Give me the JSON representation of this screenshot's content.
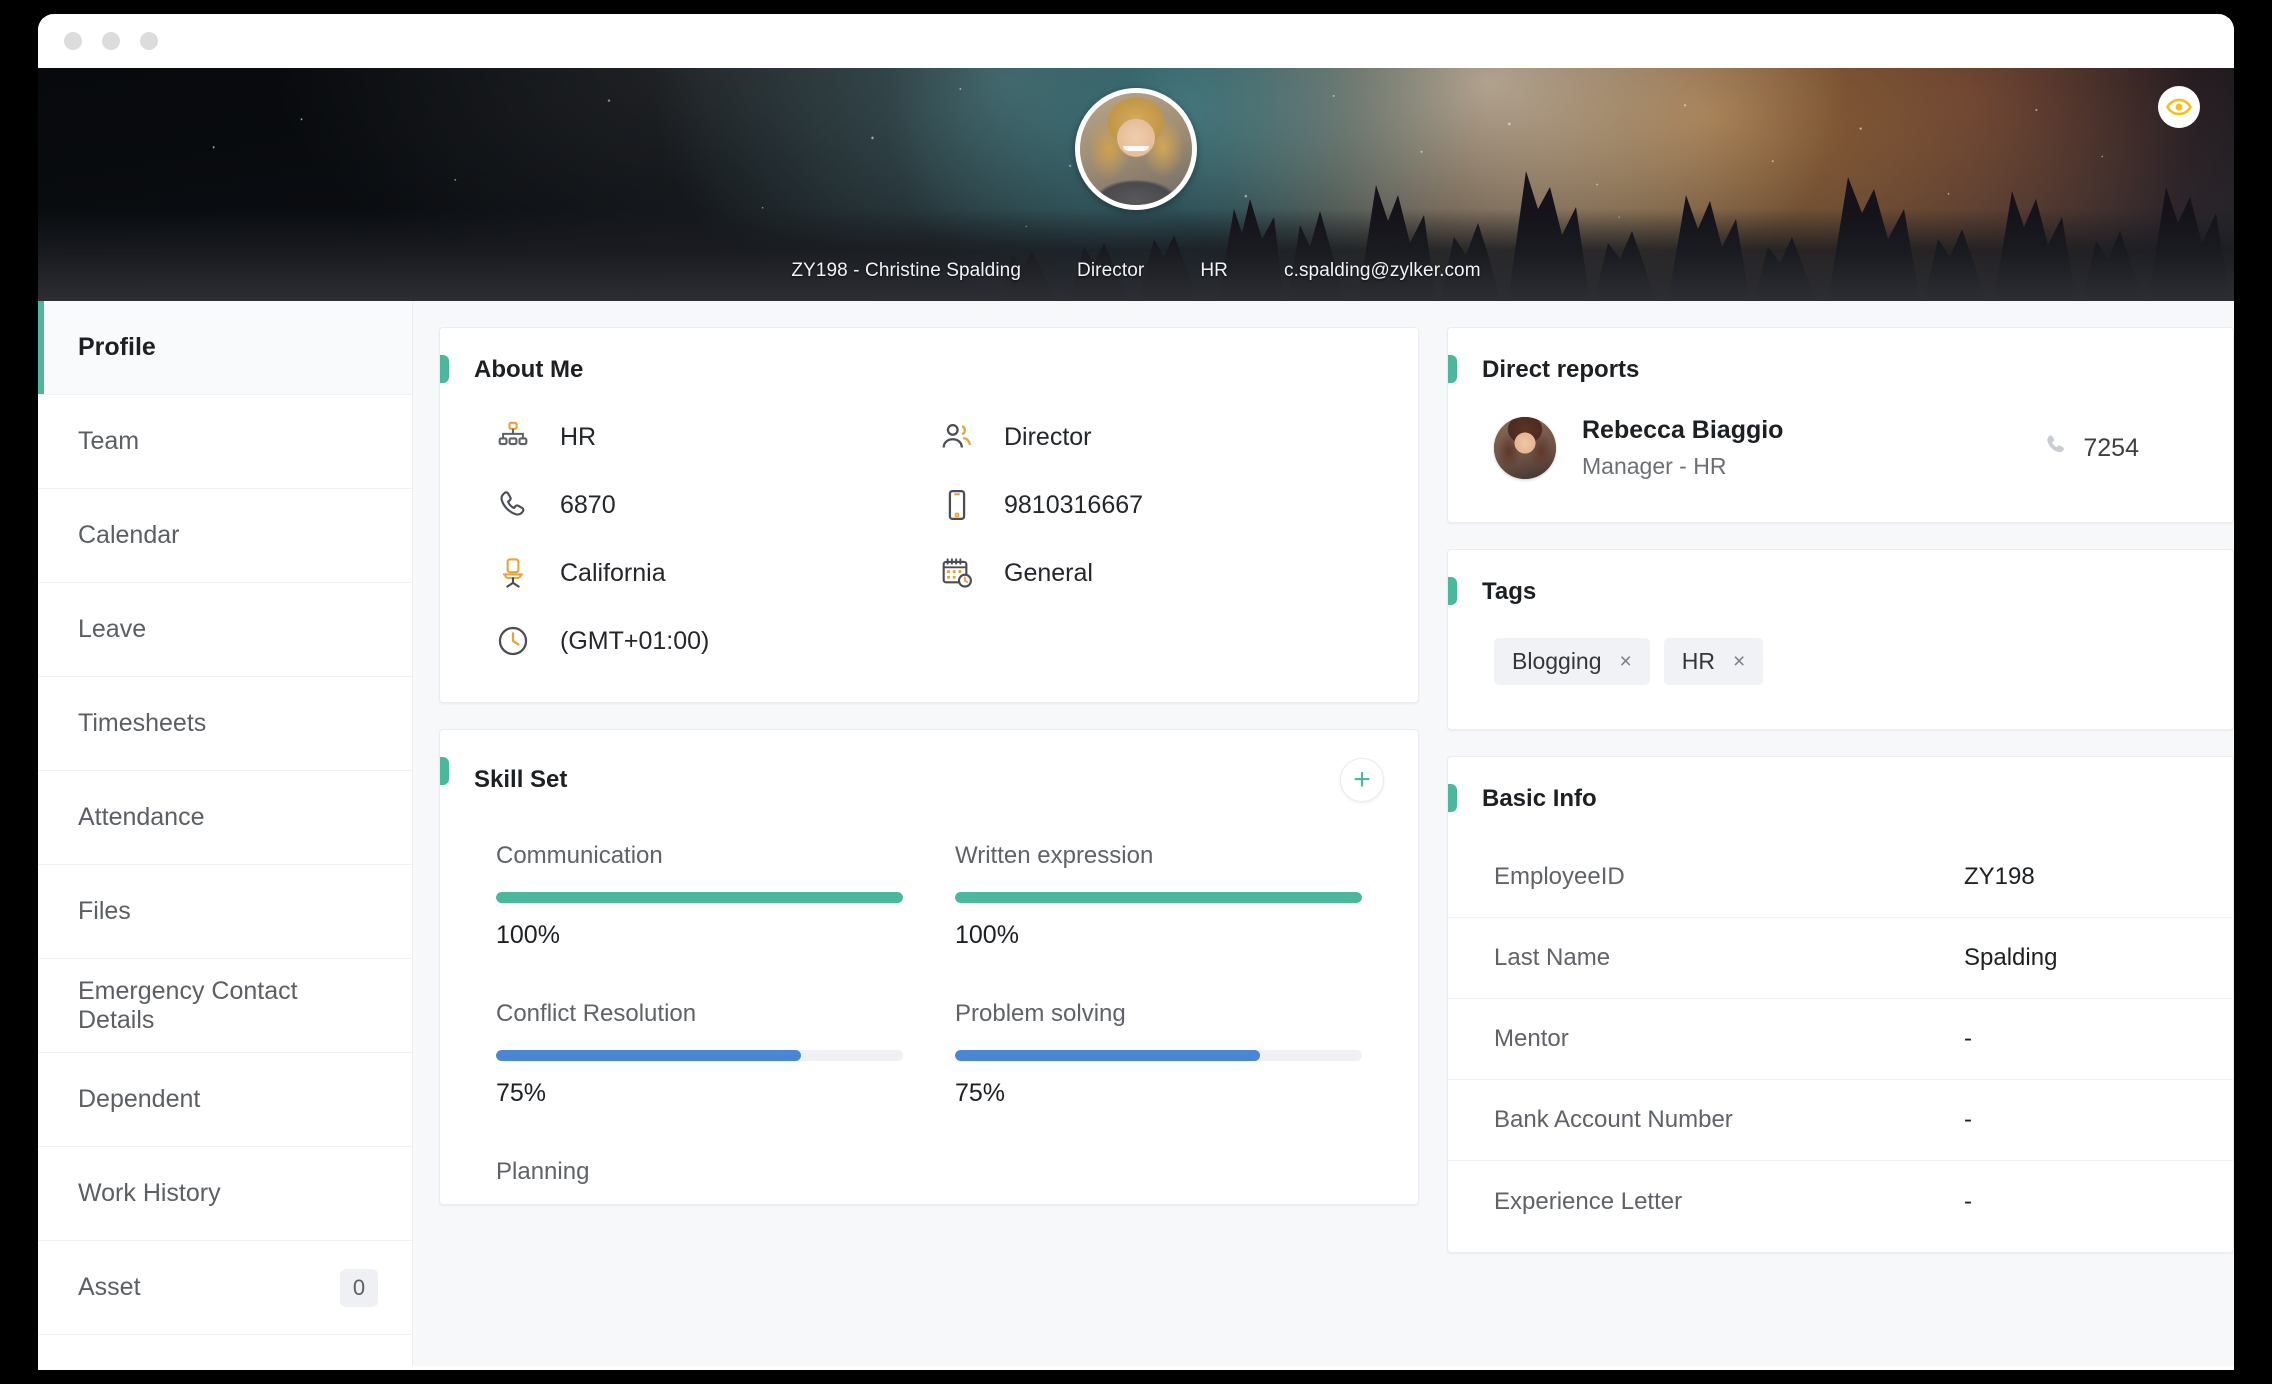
{
  "window": {
    "dots": [
      "dot-1",
      "dot-2",
      "dot-3"
    ]
  },
  "banner": {
    "employee_line": "ZY198 - Christine Spalding",
    "designation": "Director",
    "department": "HR",
    "email": "c.spalding@zylker.com",
    "eye_icon": "eye-icon",
    "avatar": "profile-photo"
  },
  "sidebar": {
    "items": [
      {
        "label": "Profile",
        "badge": "",
        "active": true
      },
      {
        "label": "Team",
        "badge": "",
        "active": false
      },
      {
        "label": "Calendar",
        "badge": "",
        "active": false
      },
      {
        "label": "Leave",
        "badge": "",
        "active": false
      },
      {
        "label": "Timesheets",
        "badge": "",
        "active": false
      },
      {
        "label": "Attendance",
        "badge": "",
        "active": false
      },
      {
        "label": "Files",
        "badge": "",
        "active": false
      },
      {
        "label": "Emergency Contact Details",
        "badge": "",
        "active": false
      },
      {
        "label": "Dependent",
        "badge": "",
        "active": false
      },
      {
        "label": "Work History",
        "badge": "",
        "active": false
      },
      {
        "label": "Asset",
        "badge": "0",
        "active": false
      }
    ]
  },
  "about_me": {
    "title": "About Me",
    "items": [
      {
        "icon": "org-chart-icon",
        "value": "HR"
      },
      {
        "icon": "users-icon",
        "value": "Director"
      },
      {
        "icon": "phone-icon",
        "value": "6870"
      },
      {
        "icon": "mobile-icon",
        "value": "9810316667"
      },
      {
        "icon": "office-chair-icon",
        "value": "California"
      },
      {
        "icon": "calendar-clock-icon",
        "value": "General"
      },
      {
        "icon": "clock-icon",
        "value": "(GMT+01:00)"
      }
    ]
  },
  "skill_set": {
    "title": "Skill Set",
    "add_label": "+",
    "skills": [
      {
        "name": "Communication",
        "percent": "100%",
        "value": 100,
        "color": "#4cb79d"
      },
      {
        "name": "Written expression",
        "percent": "100%",
        "value": 100,
        "color": "#4cb79d"
      },
      {
        "name": "Conflict Resolution",
        "percent": "75%",
        "value": 75,
        "color": "#4a86d4"
      },
      {
        "name": "Problem solving",
        "percent": "75%",
        "value": 75,
        "color": "#4a86d4"
      },
      {
        "name": "Planning",
        "percent": "",
        "value": 0,
        "color": "#4cb79d"
      }
    ]
  },
  "direct_reports": {
    "title": "Direct reports",
    "person": {
      "name": "Rebecca Biaggio",
      "role": "Manager - HR",
      "phone": "7254",
      "phone_icon": "phone-icon",
      "avatar": "report-photo"
    }
  },
  "tags": {
    "title": "Tags",
    "chips": [
      {
        "label": "Blogging",
        "remove": "×"
      },
      {
        "label": "HR",
        "remove": "×"
      }
    ]
  },
  "basic_info": {
    "title": "Basic Info",
    "rows": [
      {
        "key": "EmployeeID",
        "value": "ZY198"
      },
      {
        "key": "Last Name",
        "value": "Spalding"
      },
      {
        "key": "Mentor",
        "value": "-"
      },
      {
        "key": "Bank Account Number",
        "value": "-"
      },
      {
        "key": "Experience Letter",
        "value": "-"
      }
    ]
  },
  "colors": {
    "accent_green": "#4cb79d",
    "progress_blue": "#4a86d4",
    "icon_orange": "#e8a33d",
    "eye_gold": "#f2c21c",
    "page_bg": "#f7f8fa"
  }
}
